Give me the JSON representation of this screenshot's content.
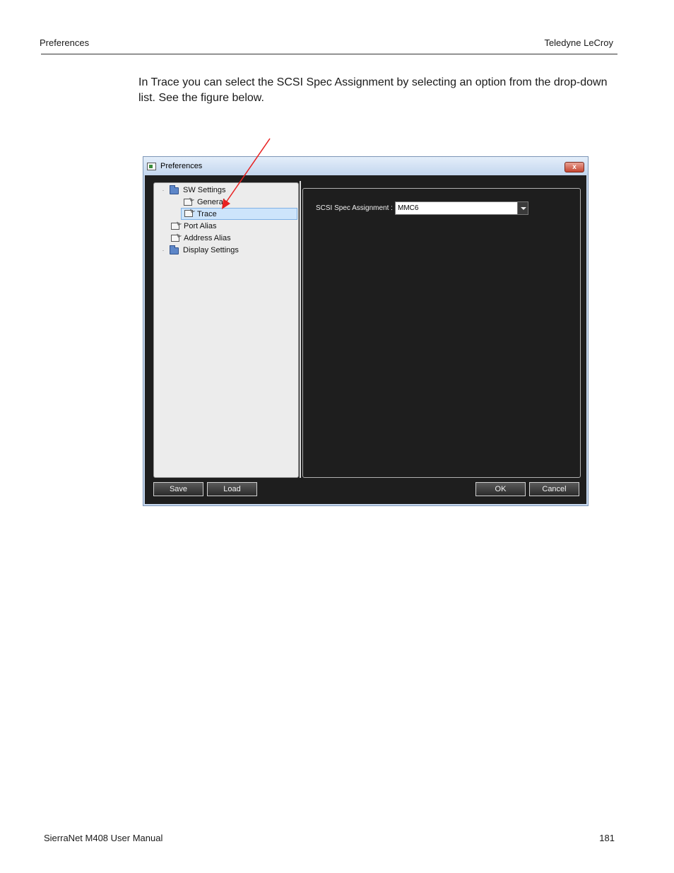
{
  "header": {
    "section": "Preferences",
    "company": "Teledyne LeCroy"
  },
  "intro_text": "In Trace you can select the SCSI Spec Assignment by selecting an option from the drop-down list. See the figure below.",
  "dialog": {
    "title": "Preferences",
    "close_glyph": "x",
    "tree": [
      {
        "label": "SW Settings",
        "expander": "·"
      },
      {
        "label": "General"
      },
      {
        "label": "Trace"
      },
      {
        "label": "Port Alias"
      },
      {
        "label": "Address Alias"
      },
      {
        "label": "Display Settings",
        "expander": "·"
      }
    ],
    "field_label": "SCSI Spec Assignment :",
    "field_value": "MMC6",
    "buttons": {
      "save": "Save",
      "load": "Load",
      "ok": "OK",
      "cancel": "Cancel"
    }
  },
  "colors": {
    "arrow": "#e82020",
    "dialog_bg": "#1e1e1e",
    "selection": "#cde4fb"
  },
  "footer": {
    "manual": "SierraNet M408 User Manual",
    "page_number": "181"
  }
}
